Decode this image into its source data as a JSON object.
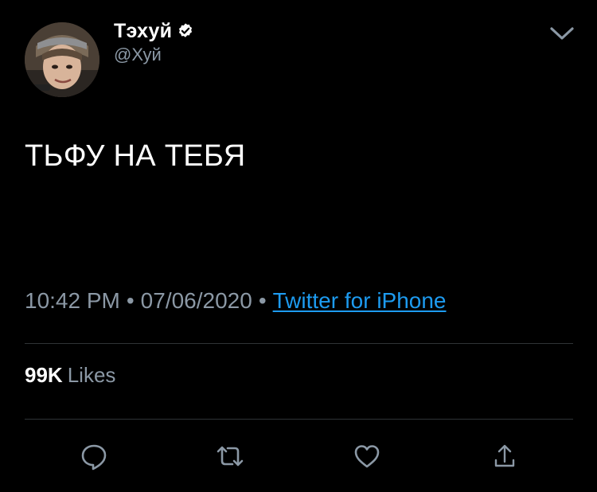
{
  "author": {
    "name": "Тэхуй",
    "handle": "@Хуй",
    "verified": true
  },
  "tweet": {
    "text": "ТЬФУ НА ТЕБЯ",
    "time": "10:42 PM",
    "separator": "•",
    "date": "07/06/2020",
    "source": "Twitter for iPhone"
  },
  "stats": {
    "likes_count": "99K",
    "likes_label": "Likes"
  },
  "icons": {
    "menu": "chevron-down-icon",
    "verified": "verified-badge-icon",
    "reply": "reply-icon",
    "retweet": "retweet-icon",
    "like": "heart-icon",
    "share": "share-icon"
  },
  "colors": {
    "background": "#000000",
    "text": "#ffffff",
    "secondary": "#8b98a5",
    "link": "#1d9bf0",
    "divider": "#2f3336"
  }
}
